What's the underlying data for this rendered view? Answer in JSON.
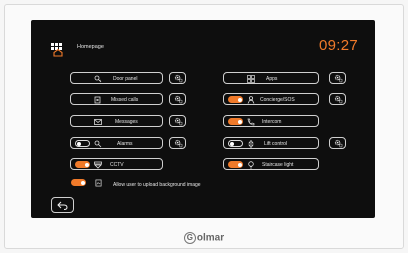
{
  "header": {
    "title": "Homepage",
    "time": "09:27"
  },
  "left_column": [
    {
      "label": "Door panel",
      "icon": "door-panel-icon",
      "toggle": null,
      "gear": true
    },
    {
      "label": "Missed calls",
      "icon": "missed-calls-icon",
      "toggle": null,
      "gear": true
    },
    {
      "label": "Messages",
      "icon": "envelope-icon",
      "toggle": null,
      "gear": true
    },
    {
      "label": "Alarms",
      "icon": "alarm-icon",
      "toggle": "off",
      "gear": true
    },
    {
      "label": "CCTV",
      "icon": "cctv-icon",
      "toggle": "on",
      "gear": false
    }
  ],
  "right_column": [
    {
      "label": "Apps",
      "icon": "apps-grid-icon",
      "toggle": null,
      "gear": true
    },
    {
      "label": "Concierge/SOS",
      "icon": "concierge-icon",
      "toggle": "on",
      "gear": true
    },
    {
      "label": "Intercom",
      "icon": "intercom-icon",
      "toggle": "on",
      "gear": false
    },
    {
      "label": "Lift control",
      "icon": "lift-icon",
      "toggle": "off",
      "gear": true
    },
    {
      "label": "Staircase light",
      "icon": "light-bulb-icon",
      "toggle": "on",
      "gear": false
    }
  ],
  "background_option": {
    "label": "Allow user to upload background image",
    "toggle": "on"
  },
  "brand": "olmar",
  "colors": {
    "accent": "#f07a2a",
    "screen": "#0e0e0e",
    "outline": "#cfcfcf"
  }
}
